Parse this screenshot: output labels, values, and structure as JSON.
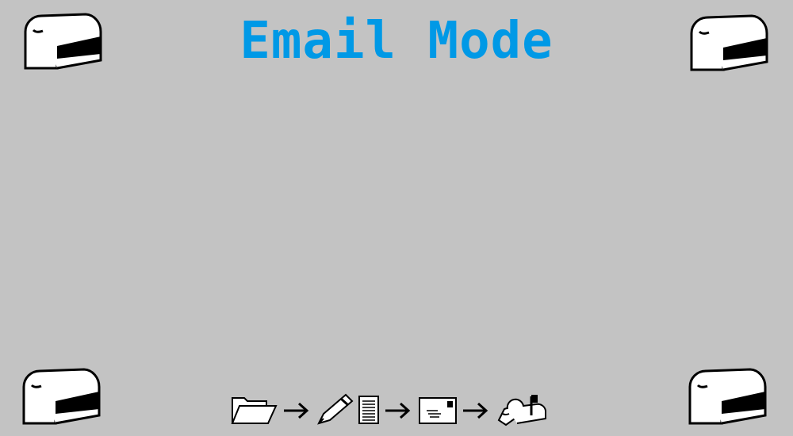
{
  "title": {
    "text": "Email Mode",
    "color": "#0099e6"
  },
  "corner_icons": [
    "mailbox-icon",
    "mailbox-icon",
    "mailbox-icon",
    "mailbox-icon"
  ],
  "workflow": [
    "open-folder-icon",
    "arrow-right-icon",
    "pen-icon",
    "document-icon",
    "arrow-right-icon",
    "envelope-icon",
    "arrow-right-icon",
    "mailbox-flag-up-icon"
  ],
  "colors": {
    "background": "#c3c3c3",
    "ink": "#000000"
  }
}
